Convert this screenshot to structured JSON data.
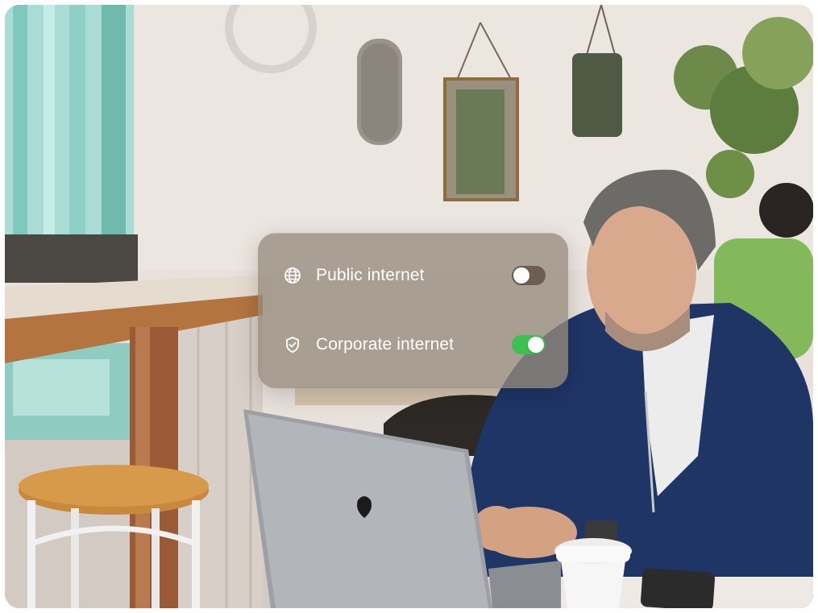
{
  "network_panel": {
    "options": [
      {
        "label": "Public internet",
        "icon": "globe-icon",
        "enabled": false
      },
      {
        "label": "Corporate internet",
        "icon": "shield-check-icon",
        "enabled": true
      }
    ]
  },
  "colors": {
    "panel_background": "#968a7c",
    "toggle_on": "#3cbf53",
    "toggle_off": "#6e5e52",
    "text": "#ffffff"
  }
}
